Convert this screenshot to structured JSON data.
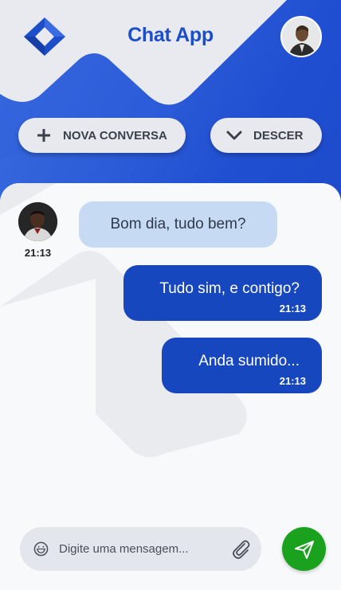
{
  "header": {
    "title": "Chat App",
    "logo_icon": "diamond-logo-icon",
    "profile_avatar": "user-avatar"
  },
  "actions": {
    "new_chat_label": "NOVA CONVERSA",
    "new_chat_icon": "plus-icon",
    "scroll_down_label": "DESCER",
    "scroll_down_icon": "chevron-down-icon"
  },
  "messages": [
    {
      "direction": "incoming",
      "text": "Bom dia, tudo bem?",
      "time": "21:13"
    },
    {
      "direction": "outgoing",
      "text": "Tudo sim, e contigo?",
      "time": "21:13"
    },
    {
      "direction": "outgoing",
      "text": "Anda sumido...",
      "time": "21:13"
    }
  ],
  "composer": {
    "placeholder": "Digite uma mensagem...",
    "emoji_icon": "emoji-icon",
    "attach_icon": "paperclip-icon",
    "send_icon": "send-icon"
  },
  "colors": {
    "primary": "#1f4fd1",
    "outgoing_bubble": "#1747bf",
    "incoming_bubble": "#c6daf3",
    "send_button": "#1aa11e"
  }
}
